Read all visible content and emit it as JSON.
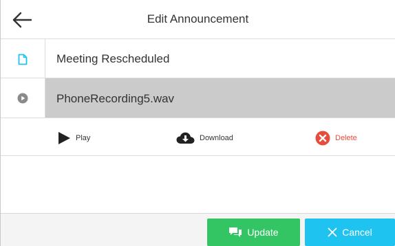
{
  "header": {
    "title": "Edit Announcement"
  },
  "announcement": {
    "title": "Meeting Rescheduled",
    "file_name": "PhoneRecording5.wav"
  },
  "actions": {
    "play_label": "Play",
    "download_label": "Download",
    "delete_label": "Delete"
  },
  "footer": {
    "update_label": "Update",
    "cancel_label": "Cancel"
  },
  "colors": {
    "update_button": "#33c463",
    "cancel_button": "#1ec3f0",
    "delete_accent": "#e74c3c",
    "document_icon": "#1ec3f0",
    "selected_row": "#cbcbcb"
  },
  "icons": {
    "back": "arrow-left-icon",
    "title_row": "document-icon",
    "file_row": "play-circle-icon",
    "play": "play-icon",
    "download": "cloud-download-icon",
    "delete": "close-circle-icon",
    "update": "chat-bubbles-icon",
    "cancel": "close-icon"
  }
}
